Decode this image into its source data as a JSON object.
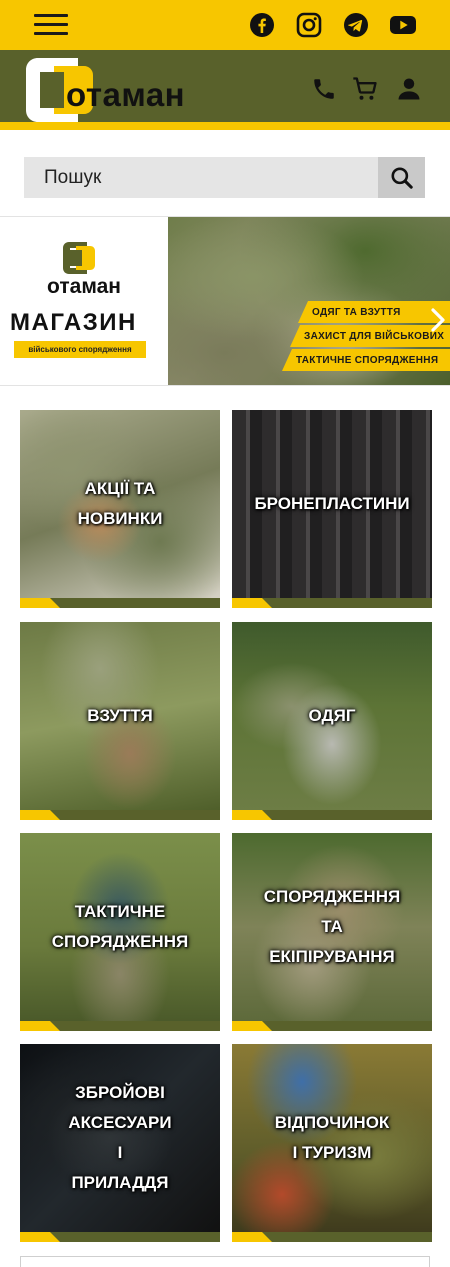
{
  "header": {
    "menu_icon": "hamburger-icon",
    "social": [
      "facebook-icon",
      "instagram-icon",
      "telegram-icon",
      "youtube-icon"
    ],
    "logo_text": "отаман",
    "actions": [
      "phone-icon",
      "cart-icon",
      "user-icon"
    ]
  },
  "search": {
    "placeholder": "Пошук",
    "button_icon": "search-icon"
  },
  "banner": {
    "logo_text": "отаман",
    "shop_title": "МАГАЗИН",
    "shop_subtitle": "військового спорядження",
    "tags": [
      "ОДЯГ ТА ВЗУТТЯ",
      "ЗАХИСТ ДЛЯ ВІЙСЬКОВИХ",
      "ТАКТИЧНЕ СПОРЯДЖЕННЯ"
    ],
    "next_icon": "chevron-right-icon"
  },
  "categories": [
    {
      "label": "АКЦІЇ ТА\nНОВИНКИ"
    },
    {
      "label": "БРОНЕПЛАСТИНИ"
    },
    {
      "label": "ВЗУТТЯ"
    },
    {
      "label": "ОДЯГ"
    },
    {
      "label": "ТАКТИЧНЕ\nСПОРЯДЖЕННЯ"
    },
    {
      "label": "СПОРЯДЖЕННЯ\nТА\nЕКІПІРУВАННЯ"
    },
    {
      "label": "ЗБРОЙОВІ\nАКСЕСУАРИ\nІ\nПРИЛАДДЯ"
    },
    {
      "label": "ВІДПОЧИНОК\nІ ТУРИЗМ"
    }
  ],
  "colors": {
    "yellow": "#f7c600",
    "olive": "#59612b"
  }
}
